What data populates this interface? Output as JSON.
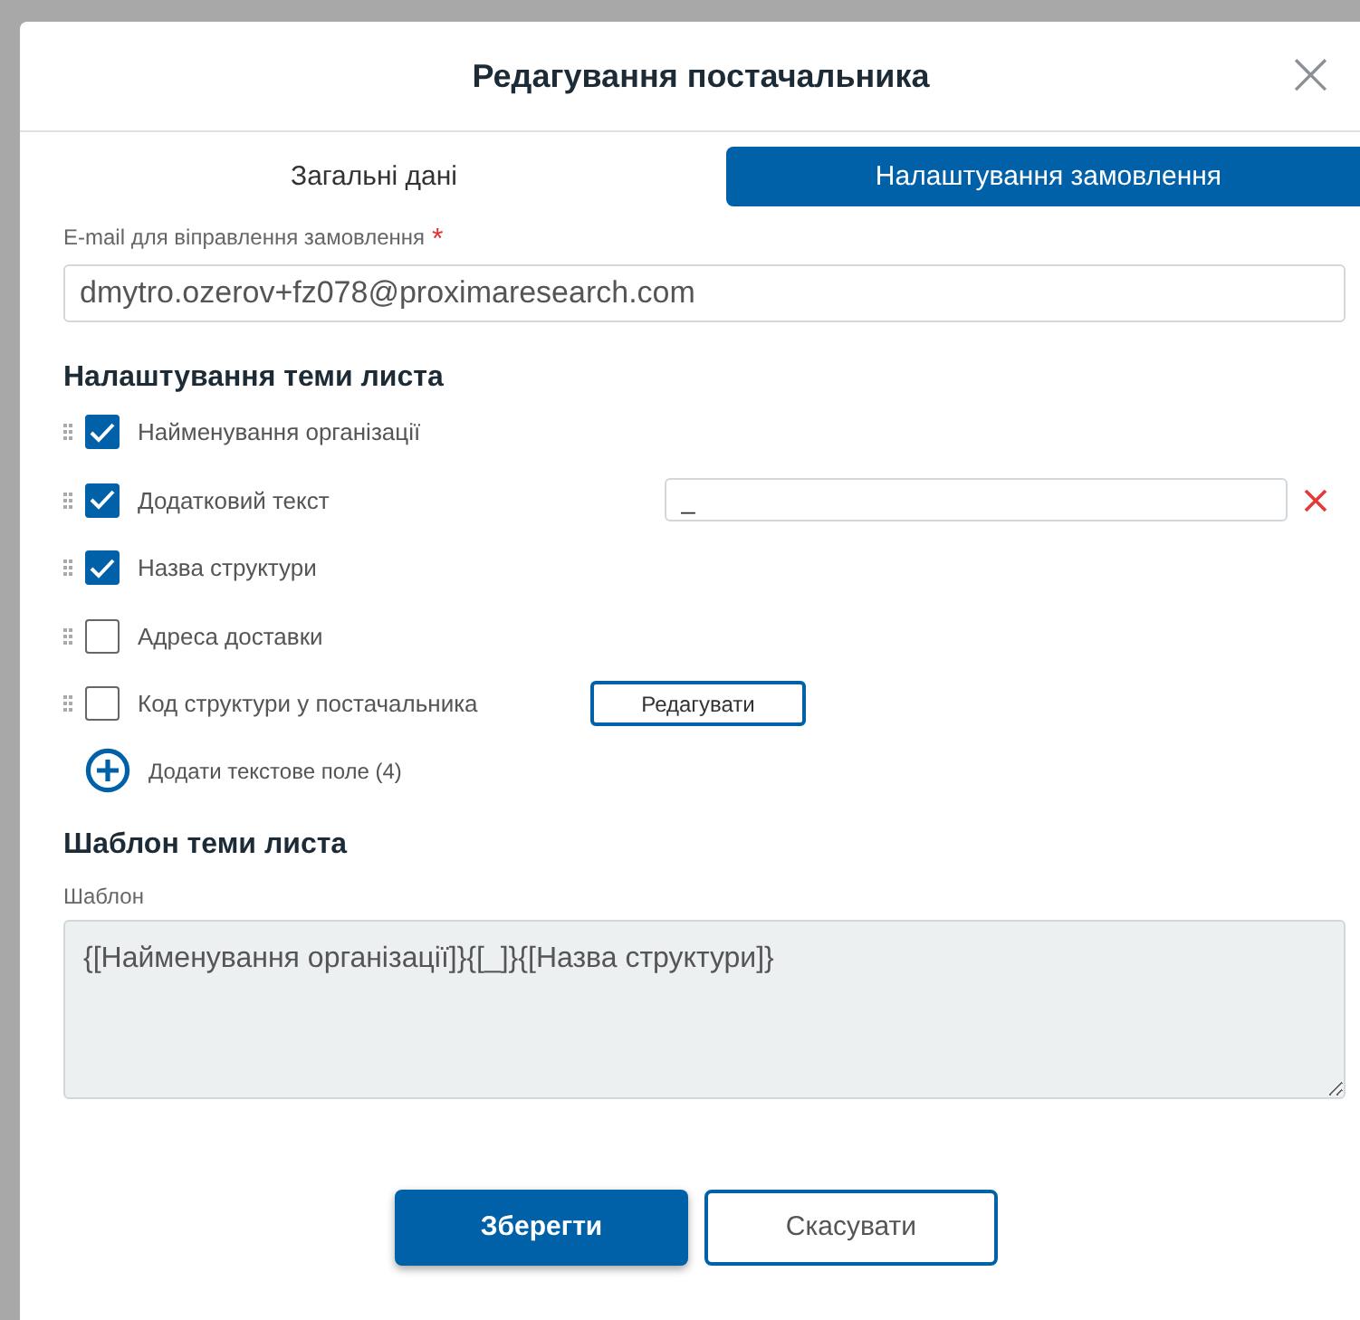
{
  "dialog": {
    "title": "Редагування постачальника",
    "close": "×"
  },
  "tabs": [
    {
      "label": "Загальні дані",
      "selected": false
    },
    {
      "label": "Налаштування замовлення",
      "selected": true
    }
  ],
  "email": {
    "label": "E-mail для віправлення замовлення",
    "required_mark": "*",
    "value": "dmytro.ozerov+fz078@proximaresearch.com"
  },
  "subject_settings": {
    "heading": "Налаштування теми листа",
    "items": [
      {
        "label": "Найменування організації",
        "checked": true,
        "kind": "plain"
      },
      {
        "label": "Додатковий текст",
        "checked": true,
        "kind": "text",
        "value": "_"
      },
      {
        "label": "Назва структури",
        "checked": true,
        "kind": "plain"
      },
      {
        "label": "Адреса доставки",
        "checked": false,
        "kind": "plain"
      },
      {
        "label": "Код структури у постачальника",
        "checked": false,
        "kind": "button",
        "button": "Редагувати"
      }
    ],
    "add_field": "Додати текстове поле (4)"
  },
  "template": {
    "heading": "Шаблон теми листа",
    "label": "Шаблон",
    "value": "{[Найменування організації]}{[_]}{[Назва структури]}"
  },
  "buttons": [
    {
      "label": "Зберегти",
      "kind": "primary"
    },
    {
      "label": "Скасувати",
      "kind": "secondary"
    }
  ]
}
